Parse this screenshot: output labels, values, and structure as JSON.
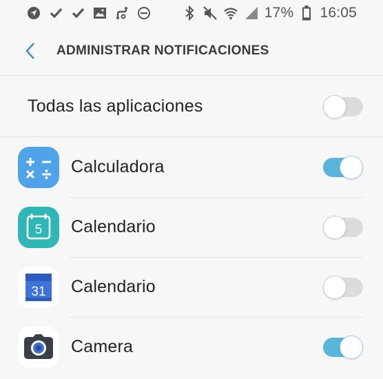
{
  "status_bar": {
    "left_icons": [
      "navigation-icon",
      "check-icon",
      "check-icon",
      "image-icon",
      "link-icon",
      "do-not-disturb-icon"
    ],
    "right_icons": [
      "bluetooth-icon",
      "mute-icon",
      "wifi-icon",
      "signal-icon"
    ],
    "battery": "17%",
    "time": "16:05"
  },
  "header": {
    "title": "ADMINISTRAR NOTIFICACIONES"
  },
  "all_apps": {
    "label": "Todas las aplicaciones",
    "enabled": false
  },
  "apps": [
    {
      "label": "Calculadora",
      "icon": "calculator-icon",
      "enabled": true
    },
    {
      "label": "Calendario",
      "icon": "samsung-calendar-icon",
      "enabled": false,
      "icon_text": "5"
    },
    {
      "label": "Calendario",
      "icon": "google-calendar-icon",
      "enabled": false,
      "icon_text": "31"
    },
    {
      "label": "Camera",
      "icon": "camera-icon",
      "enabled": true
    }
  ],
  "colors": {
    "background": "#f7f7f7",
    "accent": "#5ab5db",
    "toggle_off": "#dcdcdc",
    "back_arrow": "#4a90b8"
  }
}
